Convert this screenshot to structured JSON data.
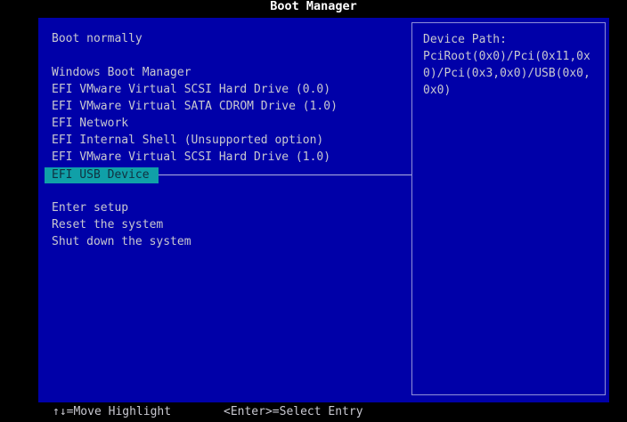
{
  "title": "Boot Manager",
  "menu": {
    "boot_normally": "Boot normally",
    "boot_entries": [
      "Windows Boot Manager",
      "EFI VMware Virtual SCSI Hard Drive (0.0)",
      "EFI VMware Virtual SATA CDROM Drive (1.0)",
      "EFI Network",
      "EFI Internal Shell (Unsupported option)",
      "EFI VMware Virtual SCSI Hard Drive (1.0)",
      "EFI USB Device"
    ],
    "actions": [
      "Enter setup",
      "Reset the system",
      "Shut down the system"
    ]
  },
  "info": {
    "label": "Device Path:",
    "lines": [
      "PciRoot(0x0)/Pci(0x11,0x",
      "0)/Pci(0x3,0x0)/USB(0x0,",
      "0x0)"
    ]
  },
  "footer": {
    "move": "↑↓=Move Highlight",
    "select": "<Enter>=Select Entry"
  },
  "colors": {
    "background": "#0000a8",
    "highlight": "#10a0a8"
  }
}
